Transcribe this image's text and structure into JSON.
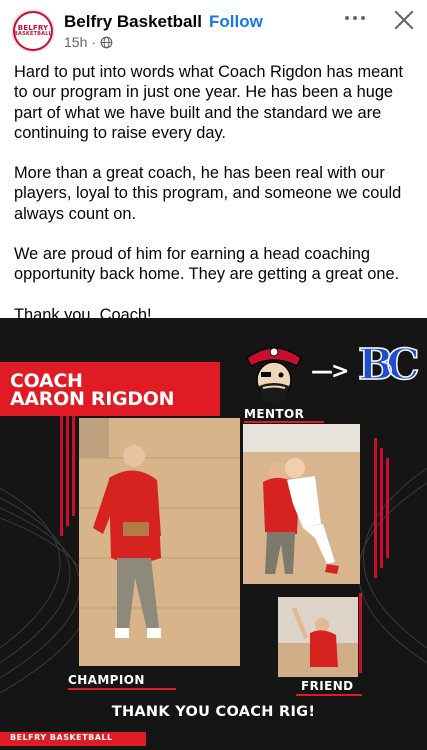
{
  "header": {
    "page_name": "Belfry Basketball",
    "separator": "·",
    "follow_label": "Follow",
    "time": "15h",
    "avatar_text_line1": "BELFRY",
    "avatar_text_line2": "BASKETBALL",
    "privacy_icon": "globe-icon",
    "more_icon": "more-options-icon",
    "close_icon": "close-icon"
  },
  "post": {
    "paragraphs": [
      "Hard to put into words what Coach Rigdon has meant to our program in just one year. He has been a huge part of what we have built and the standard we are continuing to raise every day.",
      "More than a great coach, he has been real with our players, loyal to this program, and someone we could always count on.",
      "We are proud of him for earning a head coaching opportunity back home. They are getting a great one.",
      "Thank you, Coach!"
    ]
  },
  "graphic": {
    "title_line1": "COACH",
    "title_line2": "AARON RIGDON",
    "arrow_text": "—>",
    "bc_logo_text": "BC",
    "label_mentor": "MENTOR",
    "label_champion": "CHAMPION",
    "label_friend": "FRIEND",
    "thank_you": "THANK YOU COACH RIG!",
    "footer": "BELFRY BASKETBALL"
  },
  "colors": {
    "accent_red": "#e01b24",
    "follow_blue": "#1877f2",
    "logo_blue": "#1e4fd0",
    "graphic_bg": "#151515"
  }
}
